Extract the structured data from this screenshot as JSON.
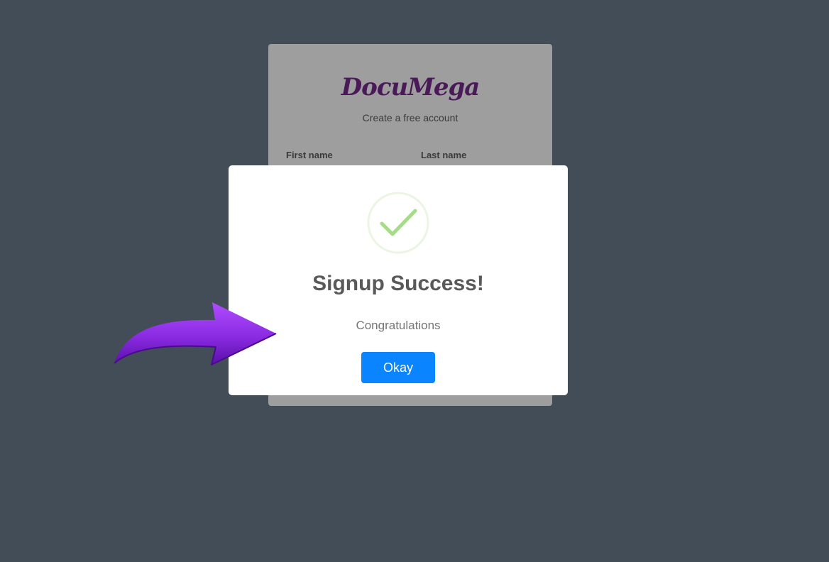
{
  "signup_card": {
    "logo": "DocuMega",
    "subtitle": "Create a free account",
    "first_name_label": "First name",
    "last_name_label": "Last name"
  },
  "modal": {
    "icon": "checkmark-success-icon",
    "title": "Signup Success!",
    "message": "Congratulations",
    "okay_label": "Okay"
  },
  "annotation": {
    "icon": "purple-arrow-icon"
  },
  "colors": {
    "background": "#434d57",
    "logo": "#4a1a58",
    "success": "#a5dc86",
    "button": "#0a84ff",
    "arrow": "#8a2be2"
  }
}
